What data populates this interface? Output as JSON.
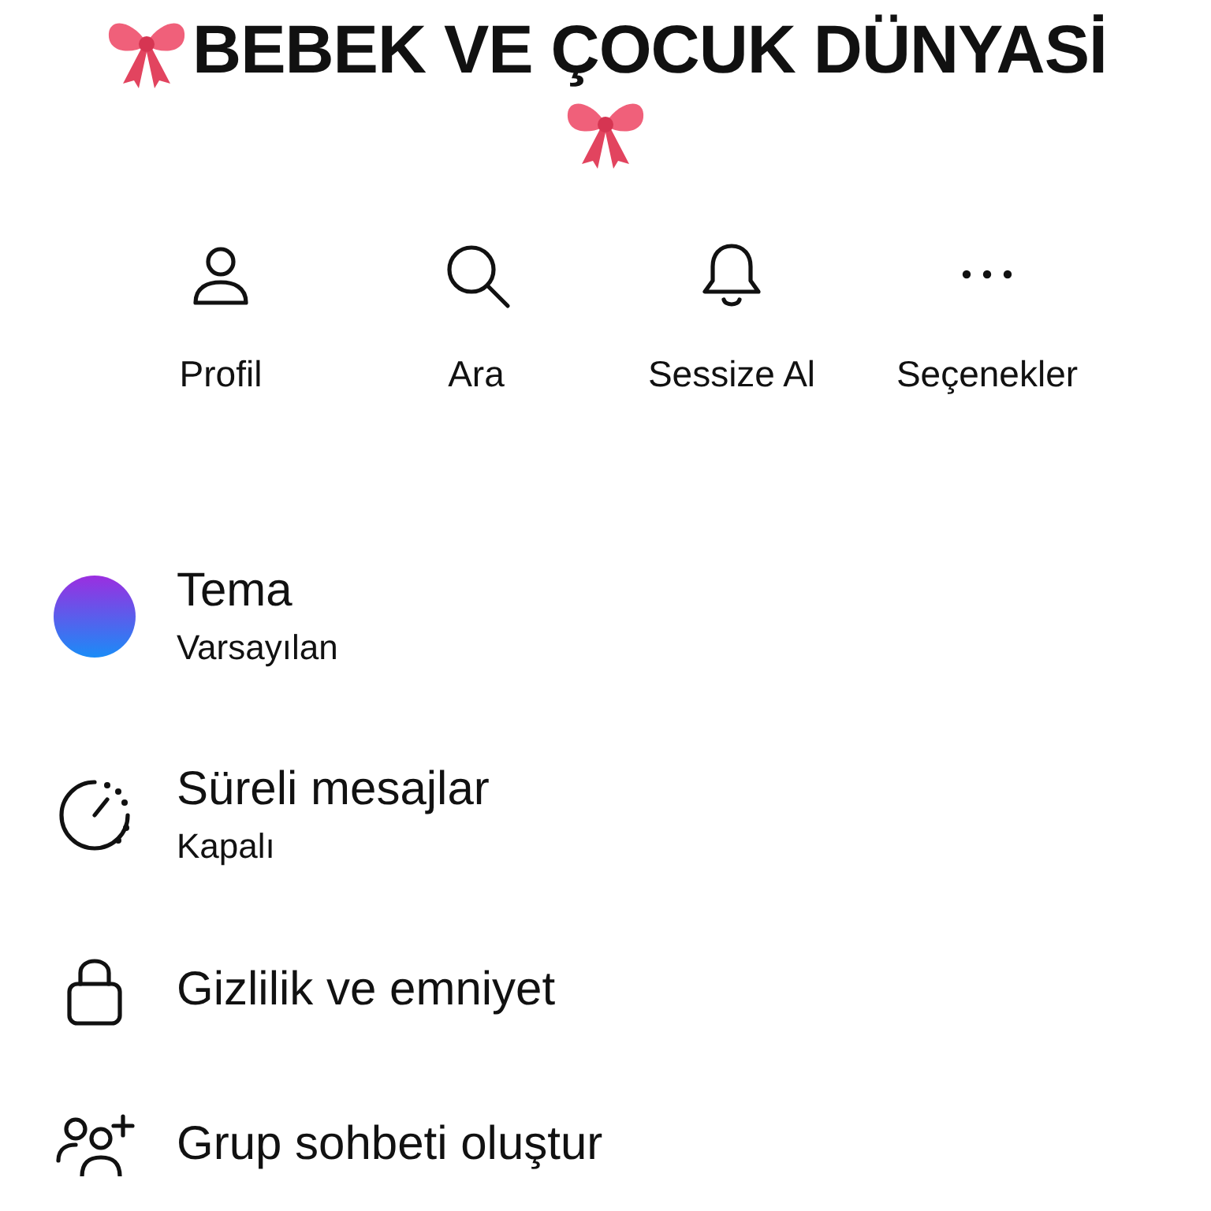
{
  "header": {
    "title": "BEBEK VE ÇOCUK DÜNYASİ"
  },
  "actions": [
    {
      "kind": "profile",
      "label": "Profil"
    },
    {
      "kind": "search",
      "label": "Ara"
    },
    {
      "kind": "bell",
      "label": "Sessize Al"
    },
    {
      "kind": "more",
      "label": "Seçenekler"
    }
  ],
  "menu": [
    {
      "kind": "theme",
      "title": "Tema",
      "subtitle": "Varsayılan"
    },
    {
      "kind": "timer",
      "title": "Süreli mesajlar",
      "subtitle": "Kapalı"
    },
    {
      "kind": "lock",
      "title": "Gizlilik ve emniyet"
    },
    {
      "kind": "group",
      "title": "Grup sohbeti oluştur"
    }
  ]
}
